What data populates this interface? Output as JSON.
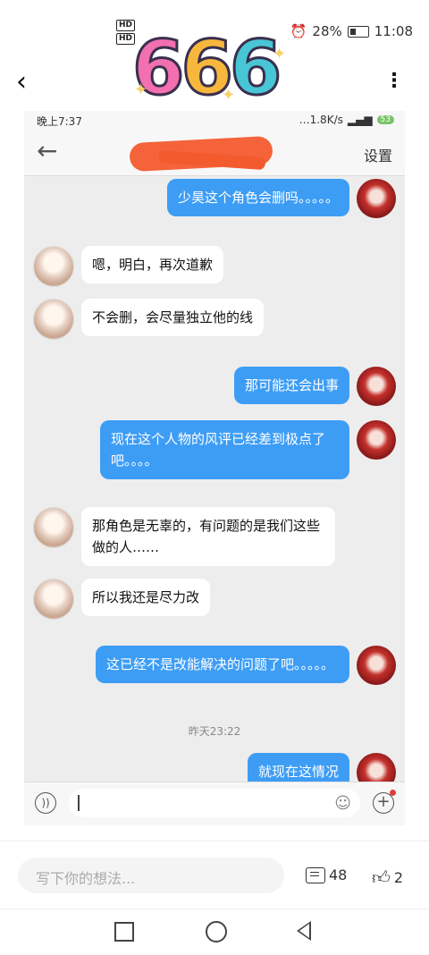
{
  "status_bar": {
    "hd1": "HD",
    "hd2": "HD",
    "battery": "28%",
    "time": "11:08"
  },
  "sticker_text": [
    "6",
    "6",
    "6"
  ],
  "inner": {
    "status": {
      "time": "晚上7:37",
      "speed": "…1.8K/s",
      "battery": "53"
    },
    "nav": {
      "settings": "设置"
    },
    "messages": [
      {
        "side": "right",
        "text": "少昊这个角色会删吗。。。。。"
      },
      {
        "side": "left",
        "text": "嗯，明白，再次道歉"
      },
      {
        "side": "left",
        "text": "不会删，会尽量独立他的线"
      },
      {
        "side": "right",
        "text": "那可能还会出事"
      },
      {
        "side": "right",
        "text": "现在这个人物的风评已经差到极点了吧。。。。"
      },
      {
        "side": "left",
        "text": "那角色是无辜的，有问题的是我们这些做的人……"
      },
      {
        "side": "left",
        "text": "所以我还是尽力改"
      },
      {
        "side": "right",
        "text": "这已经不是改能解决的问题了吧。。。。。"
      },
      {
        "side": "right",
        "text": "就现在这情况"
      }
    ],
    "timestamp": "昨天23:22"
  },
  "comment_bar": {
    "placeholder": "写下你的想法...",
    "comment_count": "48",
    "like_count": "2"
  },
  "icons": [
    "back-arrow-icon",
    "more-icon",
    "voice-icon",
    "emoji-icon",
    "plus-icon",
    "comment-icon",
    "like-icon",
    "nav-square-icon",
    "nav-circle-icon",
    "nav-back-icon"
  ]
}
